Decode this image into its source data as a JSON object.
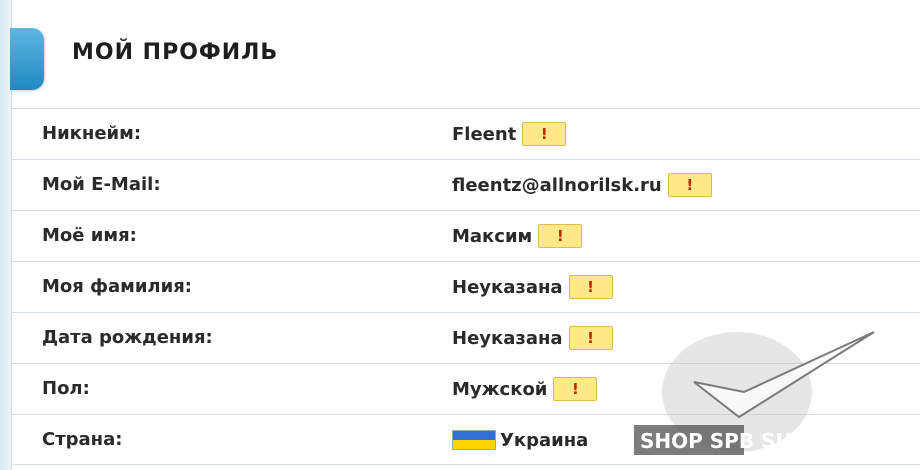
{
  "header": {
    "title": "МОЙ ПРОФИЛЬ"
  },
  "profile": {
    "rows": [
      {
        "label": "Никнейм:",
        "value": "Fleent",
        "warn": "!"
      },
      {
        "label": "Мой E-Mail:",
        "value": "fleentz@allnorilsk.ru",
        "warn": "!"
      },
      {
        "label": "Моё имя:",
        "value": "Максим",
        "warn": "!"
      },
      {
        "label": "Моя фамилия:",
        "value": "Неуказана",
        "warn": "!"
      },
      {
        "label": "Дата рождения:",
        "value": "Неуказана",
        "warn": "!"
      },
      {
        "label": "Пол:",
        "value": "Мужской",
        "warn": "!"
      },
      {
        "label": "Страна:",
        "value": "Украина",
        "warn": ""
      }
    ]
  },
  "watermark": {
    "text": "SHOP SPB SU"
  },
  "colors": {
    "accent": "#2a93c9",
    "warn_bg": "#ffe98a",
    "warn_fg": "#c02800"
  },
  "icons": {
    "flag": "ukraine-flag-icon",
    "warn": "exclamation-icon"
  }
}
